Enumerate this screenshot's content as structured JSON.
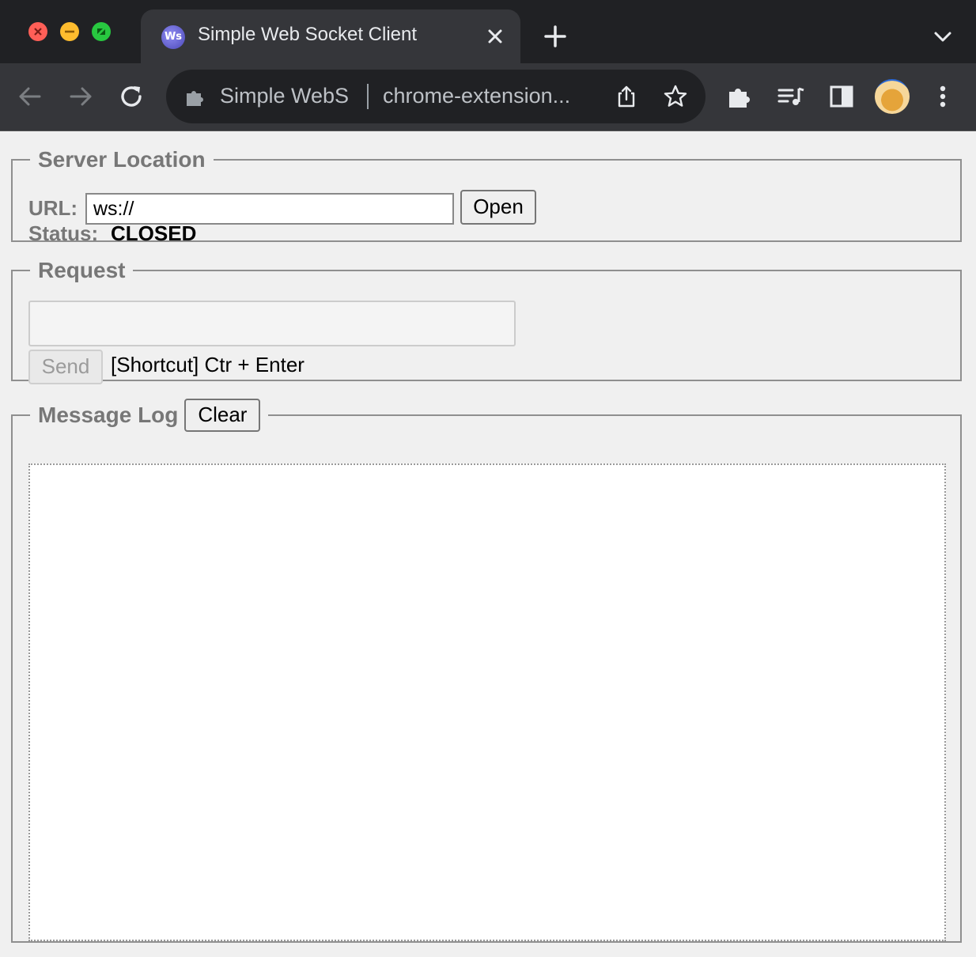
{
  "browser": {
    "tab": {
      "favicon_text": "Ws",
      "title": "Simple Web Socket Client"
    },
    "omnibox": {
      "site_name": "Simple WebS",
      "url": "chrome-extension..."
    },
    "colors": {
      "frame": "#202124",
      "toolbar": "#35363a",
      "text": "#e8eaed"
    },
    "icons": [
      "close-window-icon",
      "minimize-window-icon",
      "maximize-window-icon",
      "tab-close-icon",
      "new-tab-icon",
      "tab-search-icon",
      "back-icon",
      "forward-icon",
      "reload-icon",
      "extension-icon",
      "share-icon",
      "bookmark-star-icon",
      "extensions-puzzle-icon",
      "media-control-icon",
      "side-panel-icon",
      "profile-avatar",
      "more-menu-icon"
    ]
  },
  "server": {
    "legend": "Server Location",
    "url_label": "URL:",
    "url_value": "ws://",
    "open_label": "Open",
    "status_label": "Status:",
    "status_value": "CLOSED"
  },
  "request": {
    "legend": "Request",
    "textarea_value": "",
    "send_label": "Send",
    "shortcut_text": "[Shortcut] Ctr + Enter"
  },
  "log": {
    "legend": "Message Log",
    "clear_label": "Clear",
    "messages": []
  }
}
